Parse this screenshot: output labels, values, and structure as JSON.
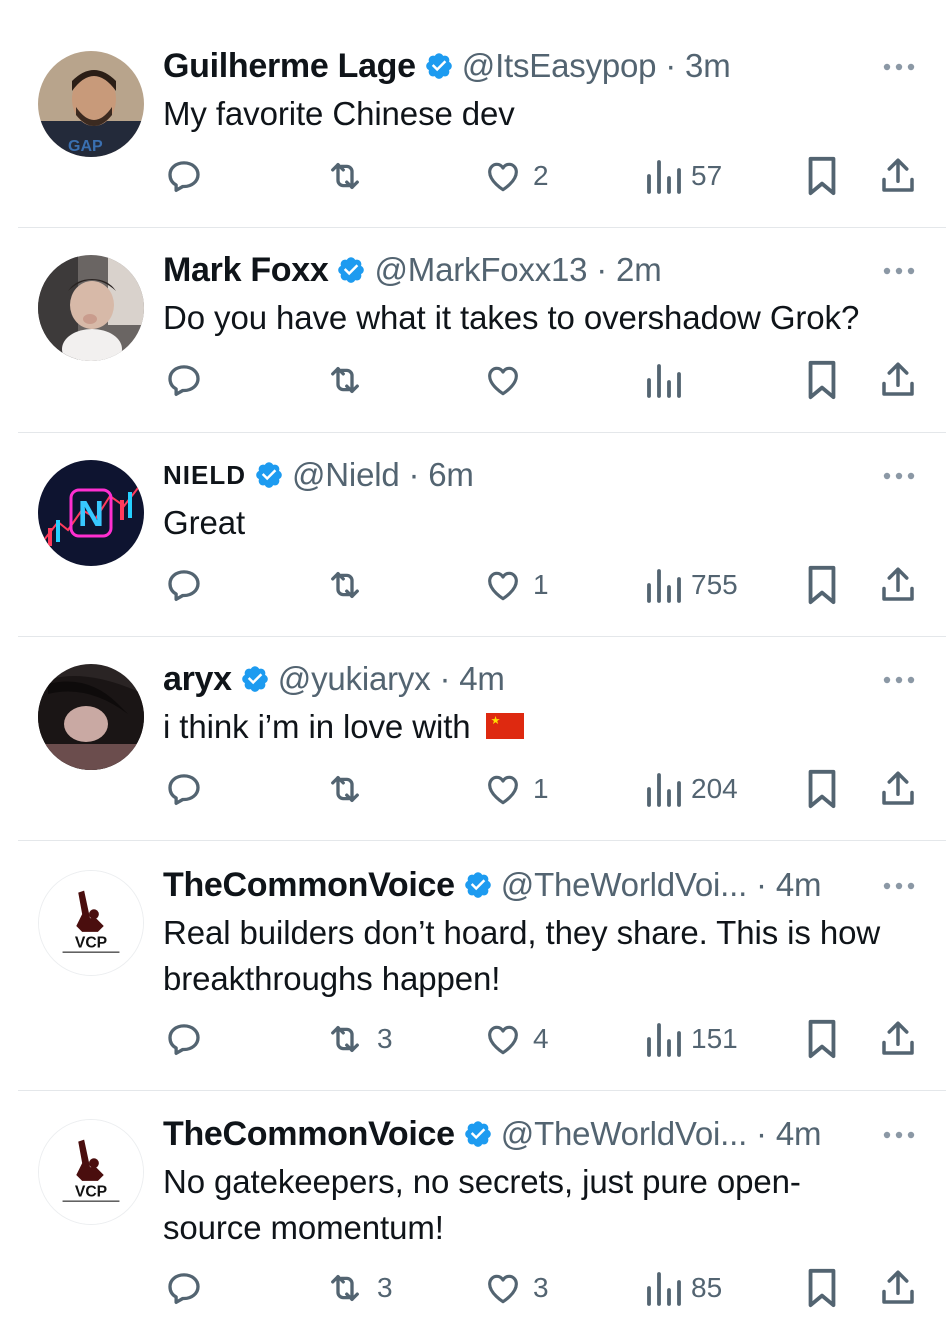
{
  "colors": {
    "verified": "#1d9bf0",
    "secondary": "#536471",
    "text": "#0f1419"
  },
  "tweets": [
    {
      "name": "Guilherme Lage",
      "handle": "@ItsEasypop",
      "time": "3m",
      "meta": "@ItsEasypop · 3m",
      "text": "My favorite Chinese dev",
      "replies": "",
      "reposts": "",
      "likes": "2",
      "views": "57"
    },
    {
      "name": "Mark Foxx",
      "handle": "@MarkFoxx13",
      "time": "2m",
      "meta": "@MarkFoxx13 · 2m",
      "text": "Do you have what it takes to overshadow Grok?",
      "replies": "",
      "reposts": "",
      "likes": "",
      "views": ""
    },
    {
      "name": "NIELD",
      "handle": "@Nield",
      "time": "6m",
      "meta": "@Nield · 6m",
      "avatar_letter": "N",
      "text": "Great",
      "replies": "",
      "reposts": "",
      "likes": "1",
      "views": "755"
    },
    {
      "name": "aryx",
      "handle": "@yukiaryx",
      "time": "4m",
      "meta": "@yukiaryx · 4m",
      "text": "i think i’m in love with",
      "emoji": "china-flag",
      "replies": "",
      "reposts": "",
      "likes": "1",
      "views": "204"
    },
    {
      "name": "TheCommonVoice",
      "handle": "@TheWorldVoi...",
      "time": "4m",
      "meta": "@TheWorldVoi... · 4m",
      "avatar_text": "VCP",
      "text": "Real builders don’t hoard,  they share. This is how breakthroughs happen!",
      "replies": "",
      "reposts": "3",
      "likes": "4",
      "views": "151"
    },
    {
      "name": "TheCommonVoice",
      "handle": "@TheWorldVoi...",
      "time": "4m",
      "meta": "@TheWorldVoi... · 4m",
      "avatar_text": "VCP",
      "text": "No gatekeepers, no secrets, just pure open-source momentum!",
      "replies": "",
      "reposts": "3",
      "likes": "3",
      "views": "85"
    }
  ]
}
